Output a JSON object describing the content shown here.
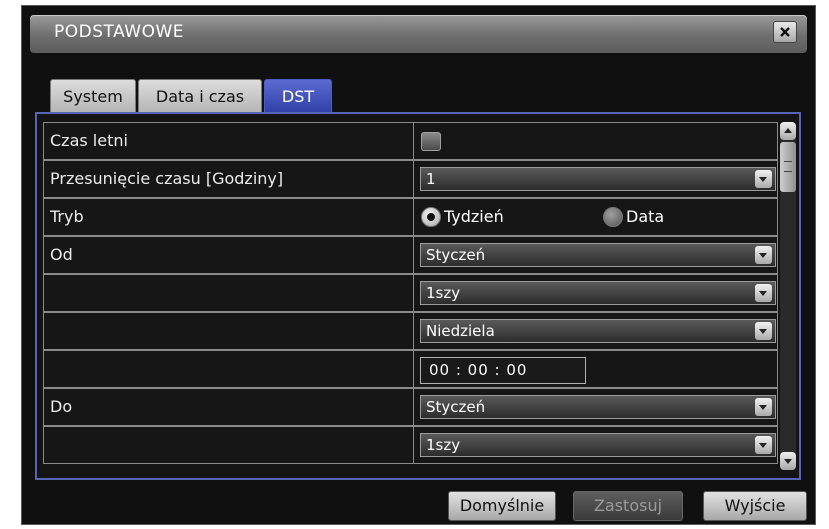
{
  "window": {
    "title": "PODSTAWOWE",
    "close_icon": "close-icon"
  },
  "tabs": [
    {
      "label": "System",
      "active": false
    },
    {
      "label": "Data i czas",
      "active": false
    },
    {
      "label": "DST",
      "active": true
    }
  ],
  "form": {
    "dst_label": "Czas letni",
    "dst_enabled": false,
    "offset_label": "Przesunięcie czasu [Godziny]",
    "offset_value": "1",
    "mode_label": "Tryb",
    "mode_options": [
      {
        "label": "Tydzień",
        "selected": true
      },
      {
        "label": "Data",
        "selected": false
      }
    ],
    "from_label": "Od",
    "from_month": "Styczeń",
    "from_week": "1szy",
    "from_day": "Niedziela",
    "from_time": "00 : 00 : 00",
    "to_label": "Do",
    "to_month": "Styczeń",
    "to_week": "1szy"
  },
  "buttons": {
    "default_label": "Domyślnie",
    "apply_label": "Zastosuj",
    "exit_label": "Wyjście"
  },
  "colors": {
    "active_tab": "#3a4bb8",
    "panel_border": "#5764b8"
  }
}
